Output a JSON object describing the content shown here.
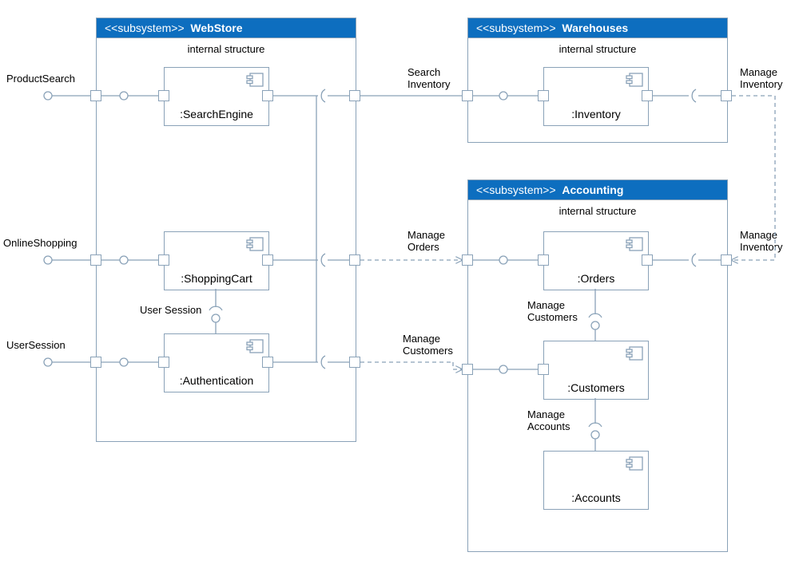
{
  "subsystems": {
    "webstore": {
      "stereo": "<<subsystem>>",
      "name": "WebStore",
      "internal": "internal structure"
    },
    "warehouses": {
      "stereo": "<<subsystem>>",
      "name": "Warehouses",
      "internal": "internal structure"
    },
    "accounting": {
      "stereo": "<<subsystem>>",
      "name": "Accounting",
      "internal": "internal structure"
    }
  },
  "components": {
    "searchengine": ":SearchEngine",
    "shoppingcart": ":ShoppingCart",
    "authentication": ":Authentication",
    "inventory": ":Inventory",
    "orders": ":Orders",
    "customers": ":Customers",
    "accounts": ":Accounts"
  },
  "labels": {
    "productsearch": "ProductSearch",
    "onlineshopping": "OnlineShopping",
    "usersession": "UserSession",
    "usersession2": "User Session",
    "searchinventory": "Search\nInventory",
    "manageinventory": "Manage\nInventory",
    "manageinventory2": "Manage\nInventory",
    "manageorders": "Manage\nOrders",
    "managecustomers": "Manage\nCustomers",
    "managecustomers2": "Manage\nCustomers",
    "manageaccounts": "Manage\nAccounts"
  }
}
